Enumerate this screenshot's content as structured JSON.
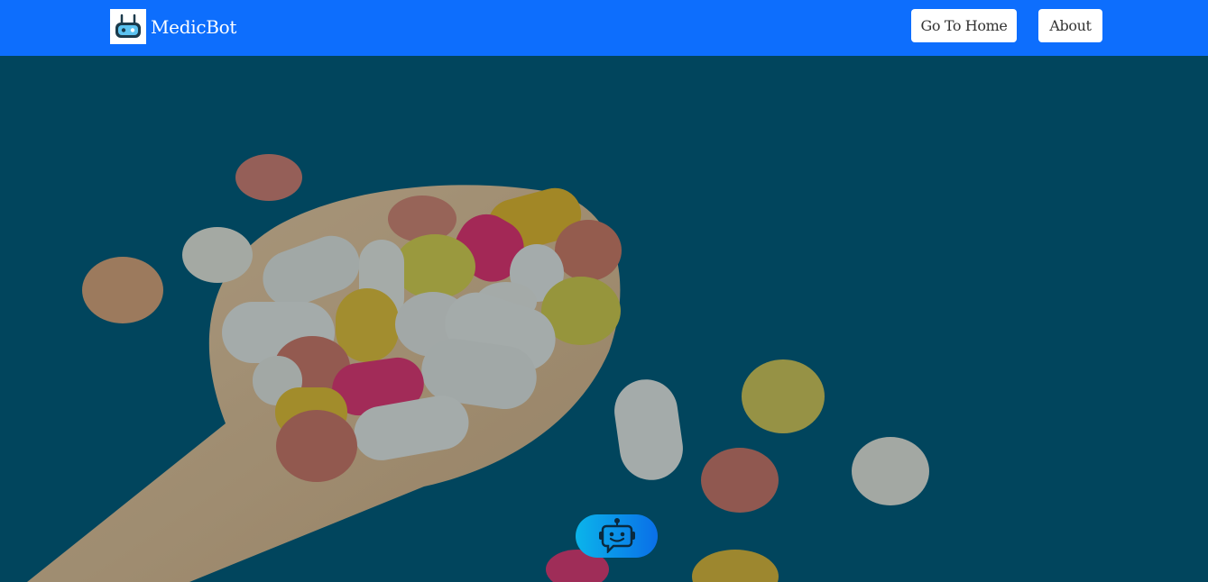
{
  "navbar": {
    "brand_name": "MedicBot",
    "logo_icon": "robot-logo-icon",
    "links": [
      {
        "label": "Go To Home"
      },
      {
        "label": "About"
      }
    ]
  },
  "colors": {
    "navbar_bg": "#0d6efd",
    "hero_bg": "#024a62",
    "chat_gradient_start": "#0bb4ea",
    "chat_gradient_end": "#0a6fe8"
  },
  "hero": {
    "image": "pills-on-wooden-spoon-background"
  },
  "chat_launcher": {
    "icon": "chatbot-icon"
  }
}
